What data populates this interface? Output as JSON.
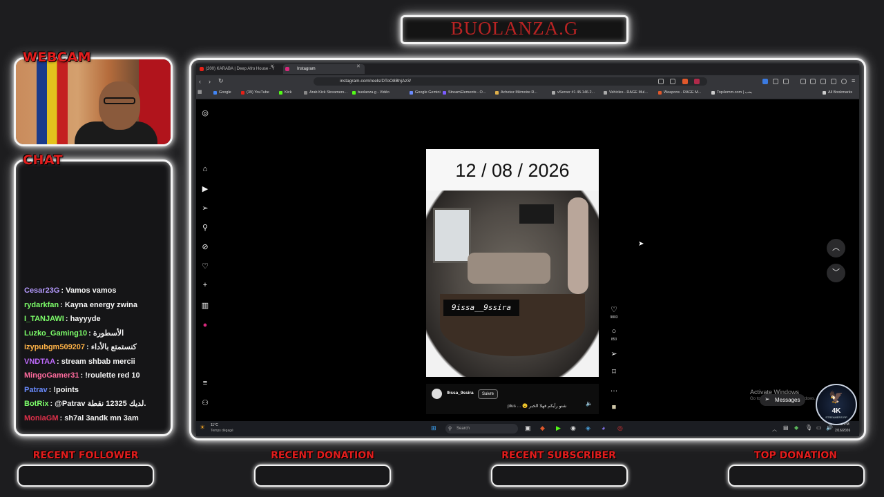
{
  "overlay": {
    "channel_title": "BUOLANZA.G",
    "webcam_label": "WEBCAM",
    "chat_label": "CHAT",
    "bottom_labels": [
      "RECENT FOLLOWER",
      "RECENT DONATION",
      "RECENT SUBSCRIBER",
      "TOP DONATION"
    ],
    "logo_text": "4K",
    "logo_sub": "STREAMERS RP"
  },
  "chat": [
    {
      "user": "Cesar23G",
      "color": "#b69bff",
      "msg": ": Vamos vamos"
    },
    {
      "user": "rydarkfan",
      "color": "#7dff6a",
      "msg": ": Kayna energy zwina"
    },
    {
      "user": "I_TANJAWI",
      "color": "#7dff6a",
      "msg": ": hayyyde"
    },
    {
      "user": "Luzko_Gaming10",
      "color": "#7dff6a",
      "msg": ": الأسطورة"
    },
    {
      "user": "izypubgm509207",
      "color": "#ffb347",
      "msg": ": كنستمتع بالأداء"
    },
    {
      "user": "VNDTAA",
      "color": "#c06bff",
      "msg": ": stream shbab mercii"
    },
    {
      "user": "MingoGamer31",
      "color": "#ff6b9e",
      "msg": ": !roulette red 10"
    },
    {
      "user": "Patrav",
      "color": "#6a8bff",
      "msg": ": !points"
    },
    {
      "user": "BotRix",
      "color": "#7dff6a",
      "msg": ": @Patrav لديك 12325 نقطة."
    },
    {
      "user": "MoniaGM",
      "color": "#e0304a",
      "msg": ": sh7al 3andk mn 3am"
    }
  ],
  "browser": {
    "tabs": [
      {
        "label": "(200) KARABA | Deep Afro House - Y",
        "active": false
      },
      {
        "label": "Instagram",
        "active": true
      }
    ],
    "url": "instagram.com/reels/DToO8BhjAz3/",
    "bookmarks": [
      "Google",
      "(39) YouTube",
      "Kick",
      "Arab Kick Streamers...",
      "buolanza.g - Vidéo",
      "Google Gemini",
      "StreamElements - O...",
      "Achetez Mémoire R...",
      "vServer #1 45.146.2...",
      "Vehicles - RAGE Mul...",
      "Weapons - RAGE M...",
      "Top4omm.com | بحب",
      "All Bookmarks"
    ]
  },
  "reel": {
    "date": "12 / 08 / 2026",
    "caption": "9issa__9ssira",
    "username": "9issa_9ssira",
    "follow_label": "Suivre",
    "text": "plus ... 😮 شنو رأيكم فهلا الخبر",
    "likes": "9803",
    "comments": "853"
  },
  "windows": {
    "activate_title": "Activate Windows",
    "activate_sub": "Go to Settings to activate Windows.",
    "messages_label": "Messages",
    "weather_temp": "11°C",
    "weather_desc": "Temps dégagé",
    "search_placeholder": "Search",
    "clock_time": "2:52 PM",
    "clock_date": "2/16/2026"
  },
  "colors": {
    "accent_red": "#e11d1d",
    "frame_white": "#f4f4f4",
    "title_red": "#b82323"
  }
}
